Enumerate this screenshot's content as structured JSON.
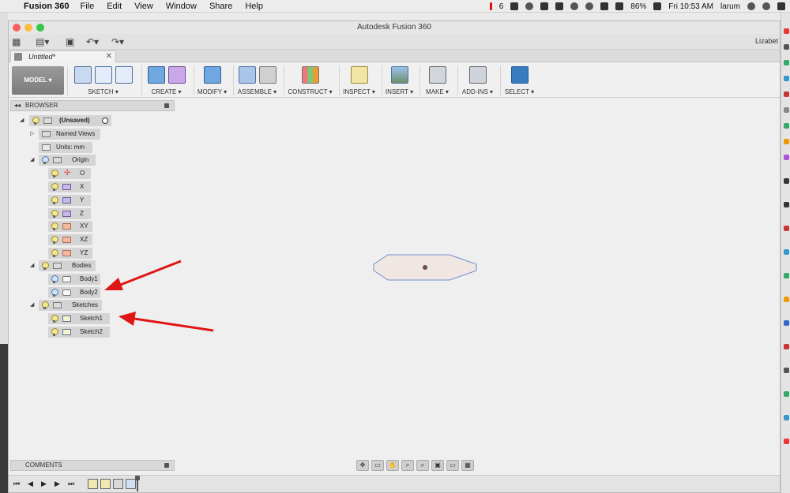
{
  "menubar": {
    "app_name": "Fusion 360",
    "items": [
      "File",
      "Edit",
      "View",
      "Window",
      "Share",
      "Help"
    ],
    "tray_badge": "6",
    "battery": "86%",
    "clock": "Fri 10:53 AM",
    "user": "larum"
  },
  "window": {
    "title": "Autodesk Fusion 360",
    "user_name": "Lizabet",
    "document_tab": "Untitled*",
    "close_label": "✕"
  },
  "ribbon": {
    "mode": "MODEL",
    "groups": [
      "SKETCH",
      "CREATE",
      "MODIFY",
      "ASSEMBLE",
      "CONSTRUCT",
      "INSPECT",
      "INSERT",
      "MAKE",
      "ADD-INS",
      "SELECT"
    ]
  },
  "browser": {
    "title": "BROWSER",
    "root": "(Unsaved)",
    "named_views": "Named Views",
    "units": "Units: mm",
    "origin": {
      "label": "Origin",
      "items": [
        "O",
        "X",
        "Y",
        "Z",
        "XY",
        "XZ",
        "YZ"
      ]
    },
    "bodies": {
      "label": "Bodies",
      "items": [
        "Body1",
        "Body2"
      ]
    },
    "sketches": {
      "label": "Sketches",
      "items": [
        "Sketch1",
        "Sketch2"
      ]
    }
  },
  "comments": {
    "title": "COMMENTS"
  },
  "colors": {
    "annotation_arrow": "#e01515",
    "select_active": "#3a7cc0",
    "body_fill": "#f0e7e2",
    "body_edge": "#6f8fd0"
  },
  "icons": [
    "apple-icon",
    "grid-icon",
    "save-icon",
    "undo-icon",
    "redo-icon",
    "lightbulb-icon",
    "folder-icon",
    "origin-icon",
    "plane-icon",
    "body-icon",
    "sketch-icon"
  ]
}
